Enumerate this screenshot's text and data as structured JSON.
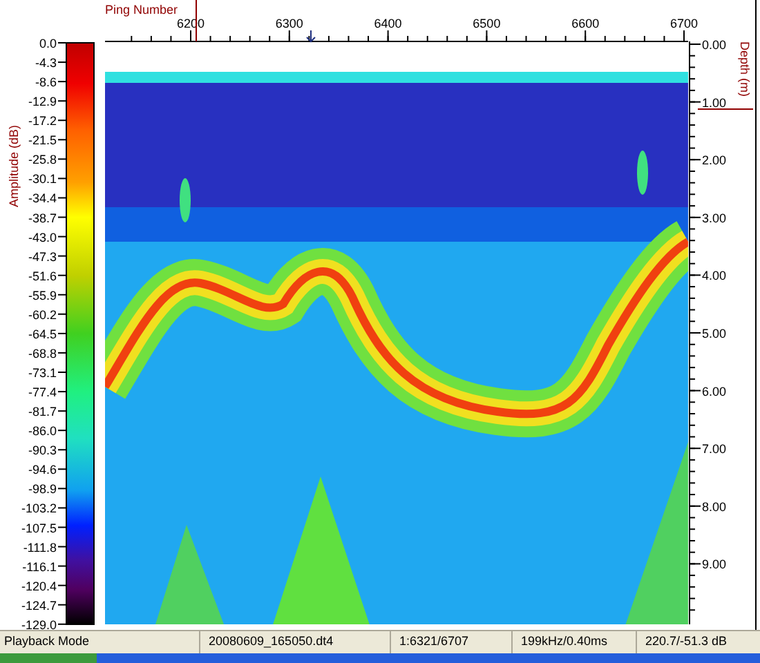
{
  "x_axis": {
    "title": "Ping Number",
    "ticks": [
      "6200",
      "6300",
      "6400",
      "6500",
      "6600",
      "6700"
    ]
  },
  "depth_axis": {
    "title": "Depth (m)",
    "ticks": [
      "0.00",
      "1.00",
      "2.00",
      "3.00",
      "4.00",
      "5.00",
      "6.00",
      "7.00",
      "8.00",
      "9.00"
    ]
  },
  "amplitude_scale": {
    "title": "Amplitude (dB)",
    "ticks": [
      "0.0",
      "-4.3",
      "-8.6",
      "-12.9",
      "-17.2",
      "-21.5",
      "-25.8",
      "-30.1",
      "-34.4",
      "-38.7",
      "-43.0",
      "-47.3",
      "-51.6",
      "-55.9",
      "-60.2",
      "-64.5",
      "-68.8",
      "-73.1",
      "-77.4",
      "-81.7",
      "-86.0",
      "-90.3",
      "-94.6",
      "-98.9",
      "-103.2",
      "-107.5",
      "-111.8",
      "-116.1",
      "-120.4",
      "-124.7",
      "-129.0"
    ]
  },
  "status_bar": [
    "Playback Mode",
    "20080609_165050.dt4",
    "1:6321/6707",
    "199kHz/0.40ms",
    "220.7/-51.3 dB"
  ]
}
